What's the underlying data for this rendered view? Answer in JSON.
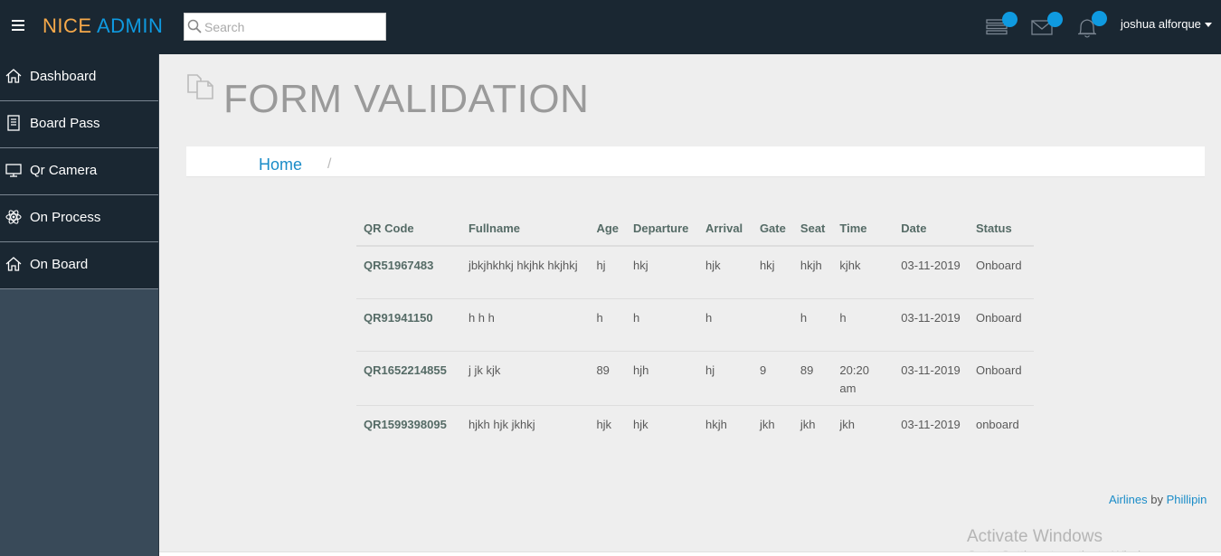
{
  "header": {
    "logo_part1": "NICE",
    "logo_part2": "ADMIN",
    "search_placeholder": "Search",
    "username": "joshua alforque",
    "icons": [
      "tasks-icon",
      "mail-icon",
      "bell-icon"
    ]
  },
  "sidebar": {
    "items": [
      {
        "label": "Dashboard",
        "icon": "home-icon"
      },
      {
        "label": "Board Pass",
        "icon": "document-icon"
      },
      {
        "label": "Qr Camera",
        "icon": "monitor-icon"
      },
      {
        "label": "On Process",
        "icon": "atom-icon"
      },
      {
        "label": "On Board",
        "icon": "home-icon"
      }
    ]
  },
  "main": {
    "title": "FORM VALIDATION",
    "breadcrumb": {
      "home": "Home",
      "separator": "/"
    }
  },
  "table": {
    "headers": [
      "QR Code",
      "Fullname",
      "Age",
      "Departure",
      "Arrival",
      "Gate",
      "Seat",
      "Time",
      "Date",
      "Status"
    ],
    "rows": [
      [
        "QR51967483",
        "jbkjhkhkj hkjhk hkjhkj",
        "hj",
        "hkj",
        "hjk",
        "hkj",
        "hkjh",
        "kjhk",
        "03-11-2019",
        "Onboard"
      ],
      [
        "QR91941150",
        "h h h",
        "h",
        "h",
        "h",
        "",
        "h",
        "h",
        "03-11-2019",
        "Onboard"
      ],
      [
        "QR1652214855",
        "j jk kjk",
        "89",
        "hjh",
        "hj",
        "9",
        "89",
        "20:20 am",
        "03-11-2019",
        "Onboard"
      ],
      [
        "QR1599398095",
        "hjkh hjk jkhkj",
        "hjk",
        "hjk",
        "hkjh",
        "jkh",
        "jkh",
        "jkh",
        "03-11-2019",
        "onboard"
      ]
    ]
  },
  "footer": {
    "link1": "Airlines",
    "by": "by",
    "link2": "Phillipin"
  },
  "watermark": {
    "title": "Activate Windows",
    "subtitle": "Go to Settings to activate Windows."
  },
  "colors": {
    "header_bg": "#1a2732",
    "sidebar_bg": "#394a59",
    "accent": "#0f9ae0",
    "logo_orange": "#f6a94a"
  }
}
